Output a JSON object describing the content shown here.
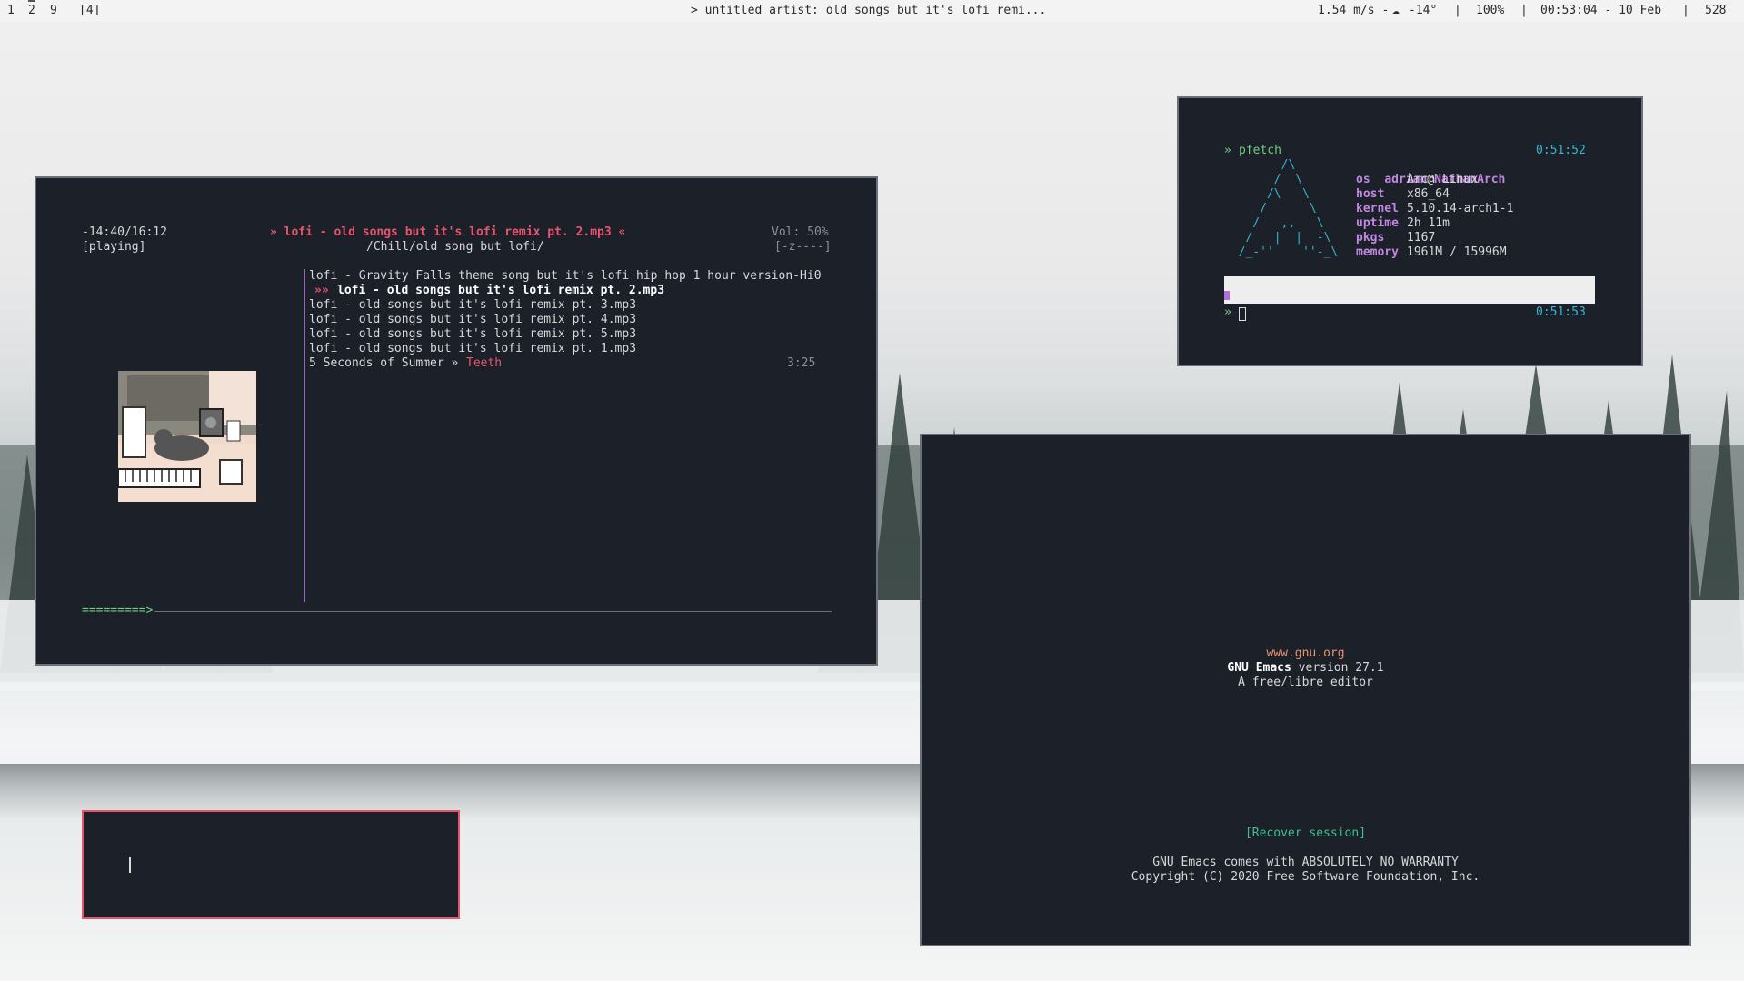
{
  "bar": {
    "workspaces": [
      "1",
      "2",
      "9"
    ],
    "layout": "[4]",
    "now_playing": "> untitled artist: old songs but it's lofi remi...",
    "net": "1.54 m/s - ",
    "weather": "-14°",
    "sep1": "|",
    "volume": "100%",
    "sep2": "|",
    "datetime": "00:53:04 - 10 Feb",
    "sep3": "|",
    "extra": "528"
  },
  "music": {
    "time": "-14:40/16:12",
    "state": "[playing]",
    "current_title": "» lofi - old songs but it's lofi remix pt. 2.mp3 «",
    "path": "/Chill/old song but lofi/",
    "volume": "Vol: 50%",
    "flags": "[-z----]",
    "queue": [
      {
        "label": "lofi - Gravity Falls theme song but it's lofi hip hop 1 hour version-Hi0"
      },
      {
        "marker": "»»",
        "label": "lofi - old songs but it's lofi remix pt. 2.mp3"
      },
      {
        "label": "lofi - old songs but it's lofi remix pt. 3.mp3"
      },
      {
        "label": "lofi - old songs but it's lofi remix pt. 4.mp3"
      },
      {
        "label": "lofi - old songs but it's lofi remix pt. 5.mp3"
      },
      {
        "label": "lofi - old songs but it's lofi remix pt. 1.mp3"
      }
    ],
    "last_artist": "5 Seconds of Summer »",
    "last_title": "Teeth",
    "last_duration": "3:25",
    "progress_text": "=========>",
    "progress_fraction": 0.095
  },
  "pfetch": {
    "prompt_symbol": "»",
    "command": "pfetch",
    "time1": "0:51:52",
    "logo": "        /\\\n       /  \\\n      /\\   \\\n     /      \\\n    /   ,,   \\\n   /   |  |  -\\\n  /_-''    ''-_\\",
    "user": "adrian",
    "at": "@",
    "host_name": "NathanArch",
    "info": [
      {
        "key": "os",
        "value": "Arch Linux"
      },
      {
        "key": "host",
        "value": "x86_64"
      },
      {
        "key": "kernel",
        "value": "5.10.14-arch1-1"
      },
      {
        "key": "uptime",
        "value": "2h 11m"
      },
      {
        "key": "pkgs",
        "value": "1167"
      },
      {
        "key": "memory",
        "value": "1961M / 15996M"
      }
    ],
    "prompt2_symbol": "»",
    "time2": "0:51:53"
  },
  "emacs": {
    "url": "www.gnu.org",
    "name": "GNU Emacs",
    "version": " version 27.1",
    "tagline": "A free/libre editor",
    "recover": "[Recover session]",
    "warranty": "GNU Emacs comes with ABSOLUTELY NO WARRANTY",
    "copyright": "Copyright (C) 2020 Free Software Foundation, Inc."
  },
  "colors": {
    "window_bg": "#1b2029",
    "accent_pink": "#e8546d",
    "accent_green": "#6fcf80",
    "accent_cyan": "#35b7cf",
    "accent_purple": "#c286e3"
  }
}
